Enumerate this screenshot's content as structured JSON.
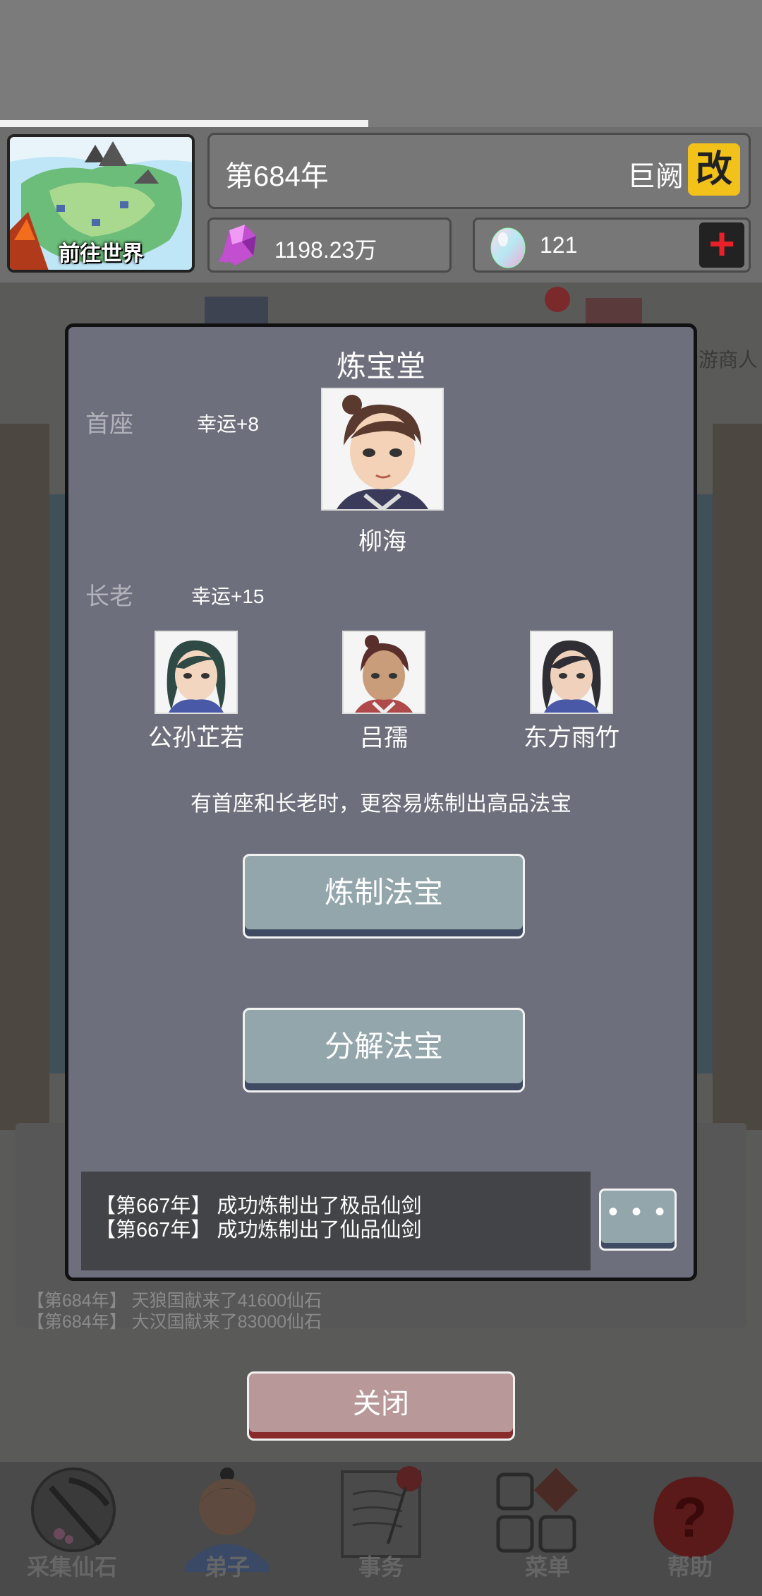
{
  "hud": {
    "world_button_label": "前往世界",
    "year": "第684年",
    "sect_name": "巨阙",
    "rename_icon_text": "改",
    "stones": "1198.23万",
    "gems": "121"
  },
  "modal": {
    "title": "炼宝堂",
    "head_label": "首座",
    "head_bonus": "幸运+8",
    "head_name": "柳海",
    "elder_label": "长老",
    "elder_bonus": "幸运+15",
    "elders": [
      {
        "name": "公孙芷若"
      },
      {
        "name": "吕孺"
      },
      {
        "name": "东方雨竹"
      }
    ],
    "hint": "有首座和长老时，更容易炼制出高品法宝",
    "refine_label": "炼制法宝",
    "dismantle_label": "分解法宝",
    "log": [
      "【第667年】 成功炼制出了极品仙剑",
      "【第667年】 成功炼制出了仙品仙剑"
    ],
    "more_label": "• • •"
  },
  "background_log": [
    "【第684年】 天狼国献来了41600仙石",
    "【第684年】 大汉国献来了83000仙石"
  ],
  "background_side_label": "游商人",
  "close_label": "关闭",
  "bottom_nav": [
    {
      "label": "采集仙石",
      "icon": "pickaxe-icon"
    },
    {
      "label": "弟子",
      "icon": "disciple-icon"
    },
    {
      "label": "事务",
      "icon": "scroll-icon"
    },
    {
      "label": "菜单",
      "icon": "menu-grid-icon"
    },
    {
      "label": "帮助",
      "icon": "help-icon"
    }
  ],
  "colors": {
    "accent_yellow": "#f2c21a",
    "plus_red": "#e8202a",
    "button_teal": "#93a6ab",
    "close_rose": "#b89898"
  }
}
